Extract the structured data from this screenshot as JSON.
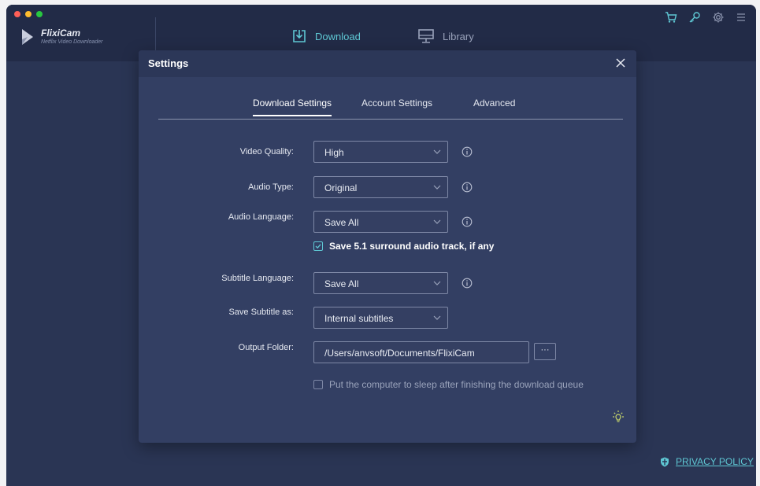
{
  "app": {
    "name": "FlixiCam",
    "subtitle": "Netflix Video Downloader"
  },
  "nav": {
    "download": "Download",
    "library": "Library"
  },
  "top_icons": [
    "cart-icon",
    "key-icon",
    "gear-icon",
    "menu-icon"
  ],
  "privacy_policy": "PRIVACY POLICY",
  "dialog": {
    "title": "Settings",
    "tabs": [
      "Download Settings",
      "Account Settings",
      "Advanced"
    ],
    "active_tab": "Download Settings",
    "rows": {
      "video_quality": {
        "label": "Video Quality:",
        "value": "High"
      },
      "audio_type": {
        "label": "Audio Type:",
        "value": "Original"
      },
      "audio_language": {
        "label": "Audio Language:",
        "value": "Save All"
      },
      "subtitle_language": {
        "label": "Subtitle Language:",
        "value": "Save All"
      },
      "save_subtitle_as": {
        "label": "Save Subtitle as:",
        "value": "Internal subtitles"
      },
      "output_folder": {
        "label": "Output Folder:",
        "value": "/Users/anvsoft/Documents/FlixiCam",
        "browse": "···"
      }
    },
    "surround_checkbox": {
      "label": "Save 5.1 surround audio track, if any",
      "checked": true
    },
    "sleep_checkbox": {
      "label": "Put the computer to sleep after finishing the download queue",
      "checked": false
    }
  },
  "colors": {
    "accent": "#5fc8d4",
    "background": "#2a3554",
    "dialog": "#333f63",
    "topbar": "#222b47"
  }
}
